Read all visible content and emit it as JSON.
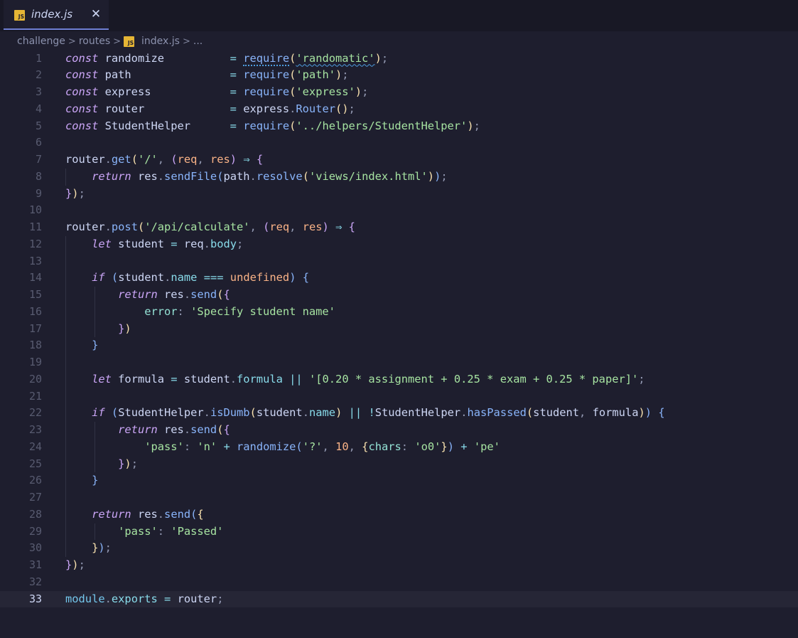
{
  "tab": {
    "icon": "JS",
    "label": "index.js",
    "close_glyph": "✕"
  },
  "breadcrumb": {
    "items": [
      "challenge",
      "routes",
      "index.js",
      "..."
    ],
    "separator": ">",
    "file_icon": "JS"
  },
  "editor": {
    "active_line": 33,
    "line_numbers": [
      "1",
      "2",
      "3",
      "4",
      "5",
      "6",
      "7",
      "8",
      "9",
      "10",
      "11",
      "12",
      "13",
      "14",
      "15",
      "16",
      "17",
      "18",
      "19",
      "20",
      "21",
      "22",
      "23",
      "24",
      "25",
      "26",
      "27",
      "28",
      "29",
      "30",
      "31",
      "32",
      "33"
    ],
    "lines": [
      [
        [
          "kw",
          "const"
        ],
        [
          "var",
          " randomize          "
        ],
        [
          "op",
          "="
        ],
        [
          "var",
          " "
        ],
        [
          "fn",
          "require"
        ],
        [
          "b1",
          "("
        ],
        [
          "str",
          "'randomatic'"
        ],
        [
          "b1",
          ")"
        ],
        [
          "pn",
          ";"
        ]
      ],
      [
        [
          "kw",
          "const"
        ],
        [
          "var",
          " path               "
        ],
        [
          "op",
          "="
        ],
        [
          "var",
          " "
        ],
        [
          "fn",
          "require"
        ],
        [
          "b1",
          "("
        ],
        [
          "str",
          "'path'"
        ],
        [
          "b1",
          ")"
        ],
        [
          "pn",
          ";"
        ]
      ],
      [
        [
          "kw",
          "const"
        ],
        [
          "var",
          " express            "
        ],
        [
          "op",
          "="
        ],
        [
          "var",
          " "
        ],
        [
          "fn",
          "require"
        ],
        [
          "b1",
          "("
        ],
        [
          "str",
          "'express'"
        ],
        [
          "b1",
          ")"
        ],
        [
          "pn",
          ";"
        ]
      ],
      [
        [
          "kw",
          "const"
        ],
        [
          "var",
          " router             "
        ],
        [
          "op",
          "="
        ],
        [
          "var",
          " express"
        ],
        [
          "pn",
          "."
        ],
        [
          "fn",
          "Router"
        ],
        [
          "b1",
          "()"
        ],
        [
          "pn",
          ";"
        ]
      ],
      [
        [
          "kw",
          "const"
        ],
        [
          "var",
          " StudentHelper      "
        ],
        [
          "op",
          "="
        ],
        [
          "var",
          " "
        ],
        [
          "fn",
          "require"
        ],
        [
          "b1",
          "("
        ],
        [
          "str",
          "'../helpers/StudentHelper'"
        ],
        [
          "b1",
          ")"
        ],
        [
          "pn",
          ";"
        ]
      ],
      [],
      [
        [
          "var",
          "router"
        ],
        [
          "pn",
          "."
        ],
        [
          "fn",
          "get"
        ],
        [
          "b1",
          "("
        ],
        [
          "str",
          "'/'"
        ],
        [
          "pn",
          ", "
        ],
        [
          "b2",
          "("
        ],
        [
          "par",
          "req"
        ],
        [
          "pn",
          ", "
        ],
        [
          "par",
          "res"
        ],
        [
          "b2",
          ")"
        ],
        [
          "var",
          " "
        ],
        [
          "op",
          "⇒"
        ],
        [
          "var",
          " "
        ],
        [
          "b2",
          "{"
        ]
      ],
      [
        [
          "var",
          "    "
        ],
        [
          "kw",
          "return"
        ],
        [
          "var",
          " res"
        ],
        [
          "pn",
          "."
        ],
        [
          "fn",
          "sendFile"
        ],
        [
          "b3",
          "("
        ],
        [
          "var",
          "path"
        ],
        [
          "pn",
          "."
        ],
        [
          "fn",
          "resolve"
        ],
        [
          "b1",
          "("
        ],
        [
          "str",
          "'views/index.html'"
        ],
        [
          "b1",
          ")"
        ],
        [
          "b3",
          ")"
        ],
        [
          "pn",
          ";"
        ]
      ],
      [
        [
          "b2",
          "}"
        ],
        [
          "b1",
          ")"
        ],
        [
          "pn",
          ";"
        ]
      ],
      [],
      [
        [
          "var",
          "router"
        ],
        [
          "pn",
          "."
        ],
        [
          "fn",
          "post"
        ],
        [
          "b1",
          "("
        ],
        [
          "str",
          "'/api/calculate'"
        ],
        [
          "pn",
          ", "
        ],
        [
          "b2",
          "("
        ],
        [
          "par",
          "req"
        ],
        [
          "pn",
          ", "
        ],
        [
          "par",
          "res"
        ],
        [
          "b2",
          ")"
        ],
        [
          "var",
          " "
        ],
        [
          "op",
          "⇒"
        ],
        [
          "var",
          " "
        ],
        [
          "b2",
          "{"
        ]
      ],
      [
        [
          "var",
          "    "
        ],
        [
          "kw",
          "let"
        ],
        [
          "var",
          " student "
        ],
        [
          "op",
          "="
        ],
        [
          "var",
          " req"
        ],
        [
          "pn",
          "."
        ],
        [
          "prop",
          "body"
        ],
        [
          "pn",
          ";"
        ]
      ],
      [],
      [
        [
          "var",
          "    "
        ],
        [
          "kw",
          "if"
        ],
        [
          "var",
          " "
        ],
        [
          "b3",
          "("
        ],
        [
          "var",
          "student"
        ],
        [
          "pn",
          "."
        ],
        [
          "prop",
          "name"
        ],
        [
          "var",
          " "
        ],
        [
          "op",
          "==="
        ],
        [
          "var",
          " "
        ],
        [
          "const",
          "undefined"
        ],
        [
          "b3",
          ")"
        ],
        [
          "var",
          " "
        ],
        [
          "b3",
          "{"
        ]
      ],
      [
        [
          "var",
          "        "
        ],
        [
          "kw",
          "return"
        ],
        [
          "var",
          " res"
        ],
        [
          "pn",
          "."
        ],
        [
          "fn",
          "send"
        ],
        [
          "b1",
          "("
        ],
        [
          "b2",
          "{"
        ]
      ],
      [
        [
          "var",
          "            "
        ],
        [
          "key",
          "error"
        ],
        [
          "pn",
          ": "
        ],
        [
          "str",
          "'Specify student name'"
        ]
      ],
      [
        [
          "var",
          "        "
        ],
        [
          "b2",
          "}"
        ],
        [
          "b1",
          ")"
        ]
      ],
      [
        [
          "var",
          "    "
        ],
        [
          "b3",
          "}"
        ]
      ],
      [],
      [
        [
          "var",
          "    "
        ],
        [
          "kw",
          "let"
        ],
        [
          "var",
          " formula "
        ],
        [
          "op",
          "="
        ],
        [
          "var",
          " student"
        ],
        [
          "pn",
          "."
        ],
        [
          "prop",
          "formula"
        ],
        [
          "var",
          " "
        ],
        [
          "op",
          "||"
        ],
        [
          "var",
          " "
        ],
        [
          "str",
          "'[0.20 * assignment + 0.25 * exam + 0.25 * paper]'"
        ],
        [
          "pn",
          ";"
        ]
      ],
      [],
      [
        [
          "var",
          "    "
        ],
        [
          "kw",
          "if"
        ],
        [
          "var",
          " "
        ],
        [
          "b3",
          "("
        ],
        [
          "var",
          "StudentHelper"
        ],
        [
          "pn",
          "."
        ],
        [
          "fn",
          "isDumb"
        ],
        [
          "b1",
          "("
        ],
        [
          "var",
          "student"
        ],
        [
          "pn",
          "."
        ],
        [
          "prop",
          "name"
        ],
        [
          "b1",
          ")"
        ],
        [
          "var",
          " "
        ],
        [
          "op",
          "||"
        ],
        [
          "var",
          " "
        ],
        [
          "op",
          "!"
        ],
        [
          "var",
          "StudentHelper"
        ],
        [
          "pn",
          "."
        ],
        [
          "fn",
          "hasPassed"
        ],
        [
          "b1",
          "("
        ],
        [
          "var",
          "student"
        ],
        [
          "pn",
          ", "
        ],
        [
          "var",
          "formula"
        ],
        [
          "b1",
          ")"
        ],
        [
          "b3",
          ")"
        ],
        [
          "var",
          " "
        ],
        [
          "b3",
          "{"
        ]
      ],
      [
        [
          "var",
          "        "
        ],
        [
          "kw",
          "return"
        ],
        [
          "var",
          " res"
        ],
        [
          "pn",
          "."
        ],
        [
          "fn",
          "send"
        ],
        [
          "b1",
          "("
        ],
        [
          "b2",
          "{"
        ]
      ],
      [
        [
          "var",
          "            "
        ],
        [
          "str",
          "'pass'"
        ],
        [
          "pn",
          ": "
        ],
        [
          "str",
          "'n'"
        ],
        [
          "var",
          " "
        ],
        [
          "op",
          "+"
        ],
        [
          "var",
          " "
        ],
        [
          "fn",
          "randomize"
        ],
        [
          "b3",
          "("
        ],
        [
          "str",
          "'?'"
        ],
        [
          "pn",
          ", "
        ],
        [
          "num",
          "10"
        ],
        [
          "pn",
          ", "
        ],
        [
          "b1",
          "{"
        ],
        [
          "key",
          "chars"
        ],
        [
          "pn",
          ": "
        ],
        [
          "str",
          "'o0'"
        ],
        [
          "b1",
          "}"
        ],
        [
          "b3",
          ")"
        ],
        [
          "var",
          " "
        ],
        [
          "op",
          "+"
        ],
        [
          "var",
          " "
        ],
        [
          "str",
          "'pe'"
        ]
      ],
      [
        [
          "var",
          "        "
        ],
        [
          "b2",
          "}"
        ],
        [
          "b1",
          ")"
        ],
        [
          "pn",
          ";"
        ]
      ],
      [
        [
          "var",
          "    "
        ],
        [
          "b3",
          "}"
        ]
      ],
      [],
      [
        [
          "var",
          "    "
        ],
        [
          "kw",
          "return"
        ],
        [
          "var",
          " res"
        ],
        [
          "pn",
          "."
        ],
        [
          "fn",
          "send"
        ],
        [
          "b3",
          "("
        ],
        [
          "b1",
          "{"
        ]
      ],
      [
        [
          "var",
          "        "
        ],
        [
          "str",
          "'pass'"
        ],
        [
          "pn",
          ": "
        ],
        [
          "str",
          "'Passed'"
        ]
      ],
      [
        [
          "var",
          "    "
        ],
        [
          "b1",
          "}"
        ],
        [
          "b3",
          ")"
        ],
        [
          "pn",
          ";"
        ]
      ],
      [
        [
          "b2",
          "}"
        ],
        [
          "b1",
          ")"
        ],
        [
          "pn",
          ";"
        ]
      ],
      [],
      [
        [
          "obj",
          "module"
        ],
        [
          "pn",
          "."
        ],
        [
          "prop",
          "exports"
        ],
        [
          "var",
          " "
        ],
        [
          "op",
          "="
        ],
        [
          "var",
          " router"
        ],
        [
          "pn",
          ";"
        ]
      ]
    ]
  },
  "colors": {
    "background": "#1e1e2e",
    "tabbar": "#181825",
    "active_line": "#262636",
    "tab_accent": "#6e7fd2",
    "js_icon": "#e5b535"
  }
}
